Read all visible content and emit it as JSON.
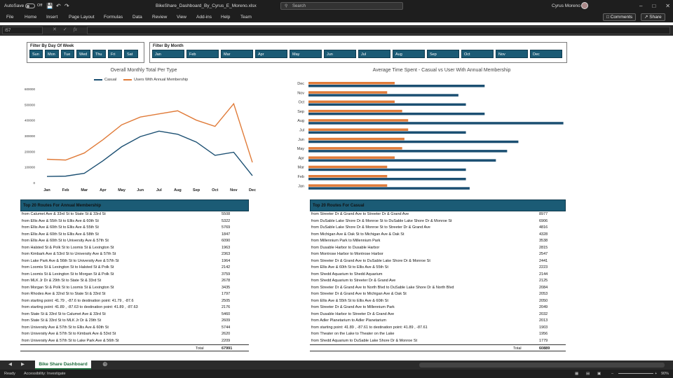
{
  "titlebar": {
    "autosave": "AutoSave",
    "autosave_state": "Off",
    "filename": "BikeShare_Dashboard_By_Cyrus_E_Moreno.xlsx",
    "search_placeholder": "Search",
    "user": "Cyrus Moreno"
  },
  "ribbon": {
    "tabs": [
      "File",
      "Home",
      "Insert",
      "Page Layout",
      "Formulas",
      "Data",
      "Review",
      "View",
      "Add-ins",
      "Help",
      "Team"
    ],
    "comments": "Comments",
    "share": "Share"
  },
  "formula": {
    "cell": "I57",
    "value": ""
  },
  "slicer_day": {
    "title": "Filter By Day Of Week",
    "items": [
      "Sun",
      "Mon",
      "Tue",
      "Wed",
      "Thu",
      "Fri",
      "Sat"
    ]
  },
  "slicer_month": {
    "title": "Filter By Month",
    "items": [
      "Jan",
      "Feb",
      "Mar",
      "Apr",
      "May",
      "Jun",
      "Jul",
      "Aug",
      "Sep",
      "Oct",
      "Nov",
      "Dec"
    ]
  },
  "chart_data": [
    {
      "type": "line",
      "title": "Overall Monthly Total  Per Type",
      "categories": [
        "Jan",
        "Feb",
        "Mar",
        "Apr",
        "May",
        "Jun",
        "Jul",
        "Aug",
        "Sep",
        "Oct",
        "Nov",
        "Dec"
      ],
      "y_ticks": [
        "0",
        "100000",
        "200000",
        "300000",
        "400000",
        "500000",
        "600000"
      ],
      "ylim": [
        0,
        600000
      ],
      "series": [
        {
          "name": "Casual",
          "color": "#1b4f72",
          "values": [
            40000,
            42000,
            60000,
            140000,
            230000,
            295000,
            330000,
            310000,
            260000,
            175000,
            195000,
            45000
          ]
        },
        {
          "name": "Users With Annual Membership",
          "color": "#e07b39",
          "values": [
            150000,
            145000,
            190000,
            275000,
            370000,
            420000,
            440000,
            460000,
            400000,
            360000,
            505000,
            130000
          ]
        }
      ]
    },
    {
      "type": "bar",
      "orientation": "horizontal",
      "title": "Average Time Spent - Casual vs User With Annual Membership",
      "categories": [
        "Dec",
        "Nov",
        "Oct",
        "Sep",
        "Aug",
        "Jul",
        "Jun",
        "May",
        "Apr",
        "Mar",
        "Feb",
        "Jan"
      ],
      "x_ticks": [
        "0:00:00",
        "0:07:12",
        "0:14:24",
        "0:21:36",
        "0:28:48",
        "0:36:00"
      ],
      "xlim_minutes": [
        0,
        36
      ],
      "series": [
        {
          "name": "Casual",
          "color": "#1b4f72",
          "values_minutes": [
            23.5,
            20,
            21,
            23.5,
            34,
            21,
            28,
            26.5,
            25,
            21,
            21,
            21.5
          ]
        },
        {
          "name": "Users With Annual Membership",
          "color": "#e07b39",
          "values_minutes": [
            11.5,
            10.5,
            11.5,
            12.5,
            13.3,
            13.3,
            12.8,
            12.5,
            11.5,
            10.5,
            10.5,
            10.5
          ]
        }
      ]
    }
  ],
  "annual_table": {
    "title": "Top 20 Routes For Annual Membership",
    "total_label": "Total",
    "total": "67991",
    "rows": [
      [
        "from Calumet Ave & 33rd St to State St & 33rd St",
        "5508"
      ],
      [
        "from Ellis Ave & 55th St to Ellis Ave & 60th St",
        "5322"
      ],
      [
        "from Ellis Ave & 60th St to Ellis Ave & 55th St",
        "5769"
      ],
      [
        "from Ellis Ave & 60th St to Ellis Ave & 58th St",
        "1847"
      ],
      [
        "from Ellis Ave & 60th St to University Ave & 57th St",
        "6090"
      ],
      [
        "from Halsted St & Polk St to Loomis St & Lexington St",
        "1963"
      ],
      [
        "from Kimbark Ave & 53rd St to University Ave & 57th St",
        "2363"
      ],
      [
        "from Lake Park Ave & 56th St to University Ave & 57th St",
        "1964"
      ],
      [
        "from Loomis St & Lexington St to Halsted St & Polk St",
        "2142"
      ],
      [
        "from Loomis St & Lexington St to Morgan St & Polk St",
        "3759"
      ],
      [
        "from MLK Jr Dr & 29th St to State St & 33rd St",
        "2678"
      ],
      [
        "from Morgan St & Polk St to Loomis St & Lexington St",
        "3435"
      ],
      [
        "from Rhodes Ave & 32nd St to State St & 33rd St",
        "1797"
      ],
      [
        "from starting point: 41.79 , -87.6 to destination point: 41.79 , -87.6",
        "2505"
      ],
      [
        "from starting point: 41.89 , -87.63 to destination point: 41.89 , -87.63",
        "2176"
      ],
      [
        "from State St & 33rd St to Calumet Ave & 33rd St",
        "5460"
      ],
      [
        "from State St & 33rd St to MLK Jr Dr & 29th St",
        "2609"
      ],
      [
        "from University Ave & 57th St to Ellis Ave & 60th St",
        "5744"
      ],
      [
        "from University Ave & 57th St to Kimbark Ave & 53rd St",
        "2620"
      ],
      [
        "from University Ave & 57th St to Lake Park Ave & 56th St",
        "2209"
      ]
    ]
  },
  "casual_table": {
    "title": "Top 20 Routes For Casual",
    "total_label": "Total",
    "total": "60889",
    "rows": [
      [
        "from Streeter Dr & Grand Ave to Streeter Dr & Grand Ave",
        "8977"
      ],
      [
        "from DuSable Lake Shore Dr & Monroe St to DuSable Lake Shore Dr & Monroe St",
        "6906"
      ],
      [
        "from DuSable Lake Shore Dr & Monroe St to Streeter Dr & Grand Ave",
        "4816"
      ],
      [
        "from Michigan Ave & Oak St to Michigan Ave & Oak St",
        "4328"
      ],
      [
        "from Millennium Park to Millennium Park",
        "3538"
      ],
      [
        "from Dusable Harbor to Dusable Harbor",
        "2815"
      ],
      [
        "from Montrose Harbor to Montrose Harbor",
        "2547"
      ],
      [
        "from Streeter Dr & Grand Ave to DuSable Lake Shore Dr & Monroe St",
        "2441"
      ],
      [
        "from Ellis Ave & 60th St to Ellis Ave & 55th St",
        "2223"
      ],
      [
        "from Shedd Aquarium to Shedd Aquarium",
        "2144"
      ],
      [
        "from Shedd Aquarium to Streeter Dr & Grand Ave",
        "2125"
      ],
      [
        "from Streeter Dr & Grand Ave to North Blvd to DuSable Lake Shore Dr & North Blvd",
        "2084"
      ],
      [
        "from Streeter Dr & Grand Ave to Michigan Ave & Oak St",
        "2053"
      ],
      [
        "from Ellis Ave & 55th St to Ellis Ave & 60th St",
        "2050"
      ],
      [
        "from Streeter Dr & Grand Ave to Millennium Park",
        "2049"
      ],
      [
        "from Dusable Harbor to Streeter Dr & Grand Ave",
        "2032"
      ],
      [
        "from Adler Planetarium to Adler Planetarium",
        "2013"
      ],
      [
        "from starting point: 41.89 , -87.61 to destination point: 41.89 , -87.61",
        "1903"
      ],
      [
        "from Theater on the Lake to Theater on the Lake",
        "1956"
      ],
      [
        "from Shedd Aquarium to DuSable Lake Shore Dr & Monroe St",
        "1779"
      ]
    ]
  },
  "sheet_tab": "Bike Share Dashboard",
  "status": {
    "ready": "Ready",
    "accessibility": "Accessibility: Investigate",
    "zoom": "90%"
  },
  "icons": {
    "save": "save-icon",
    "undo": "undo-icon",
    "redo": "redo-icon",
    "search": "search-icon",
    "comments": "comment-icon",
    "share": "share-icon"
  }
}
